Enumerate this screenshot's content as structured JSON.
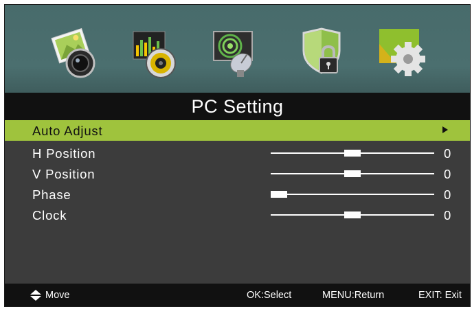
{
  "icons": [
    {
      "name": "picture-icon"
    },
    {
      "name": "sound-icon"
    },
    {
      "name": "channel-icon"
    },
    {
      "name": "lock-icon"
    },
    {
      "name": "setup-icon"
    }
  ],
  "title": "PC Setting",
  "menu": {
    "items": [
      {
        "label": "Auto Adjust"
      },
      {
        "label": "H Position",
        "value": "0",
        "level": 0.5
      },
      {
        "label": "V Position",
        "value": "0",
        "level": 0.5
      },
      {
        "label": "Phase",
        "value": "0",
        "level": 0.0
      },
      {
        "label": "Clock",
        "value": "0",
        "level": 0.5
      }
    ]
  },
  "footer": {
    "move": "Move",
    "ok": "OK:Select",
    "menu": "MENU:Return",
    "exit": "EXIT: Exit"
  },
  "colors": {
    "highlight": "#9fc33d",
    "panel": "#3c3c3c",
    "bar": "#111111",
    "iconbar": "#4b6f6f"
  }
}
